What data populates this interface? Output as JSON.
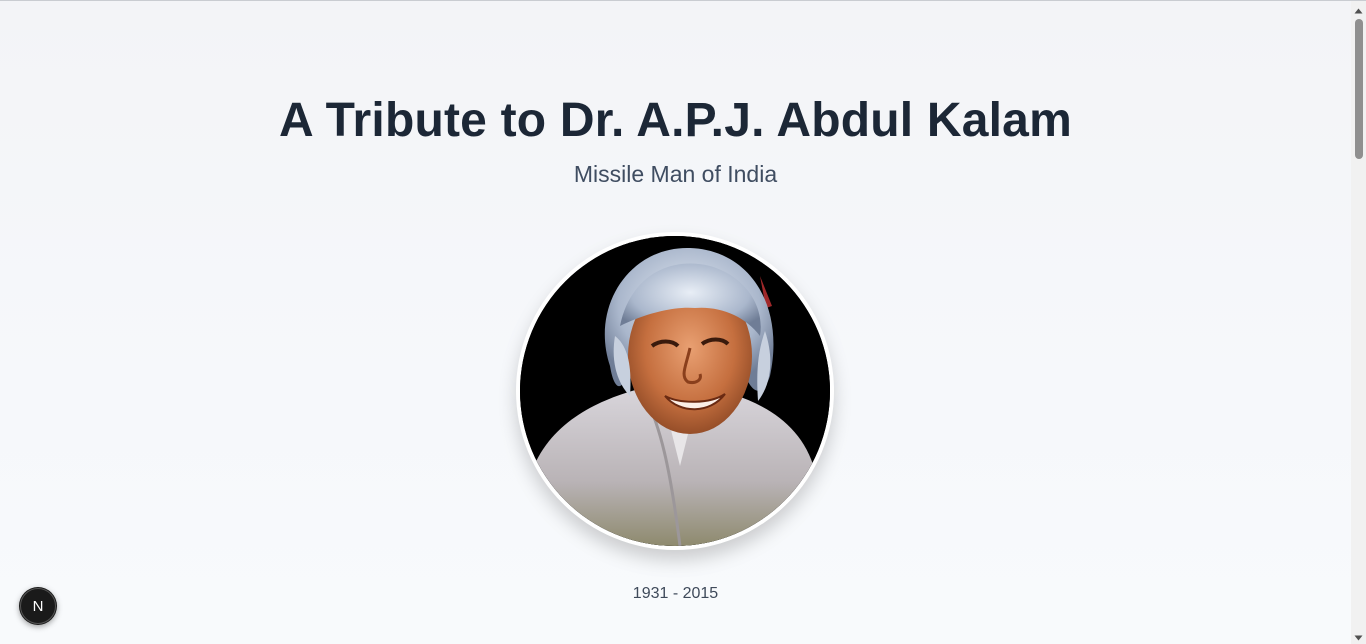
{
  "header": {
    "title": "A Tribute to Dr. A.P.J. Abdul Kalam",
    "subtitle": "Missile Man of India"
  },
  "portrait": {
    "icon": "portrait-photo"
  },
  "life": {
    "years": "1931 - 2015"
  },
  "dev_badge": {
    "letter": "N",
    "icon": "nextjs-icon"
  },
  "colors": {
    "title": "#1c2736",
    "subtitle": "#3f4d61",
    "background": "#f5f7fa",
    "badge": "#1a1a1a"
  }
}
